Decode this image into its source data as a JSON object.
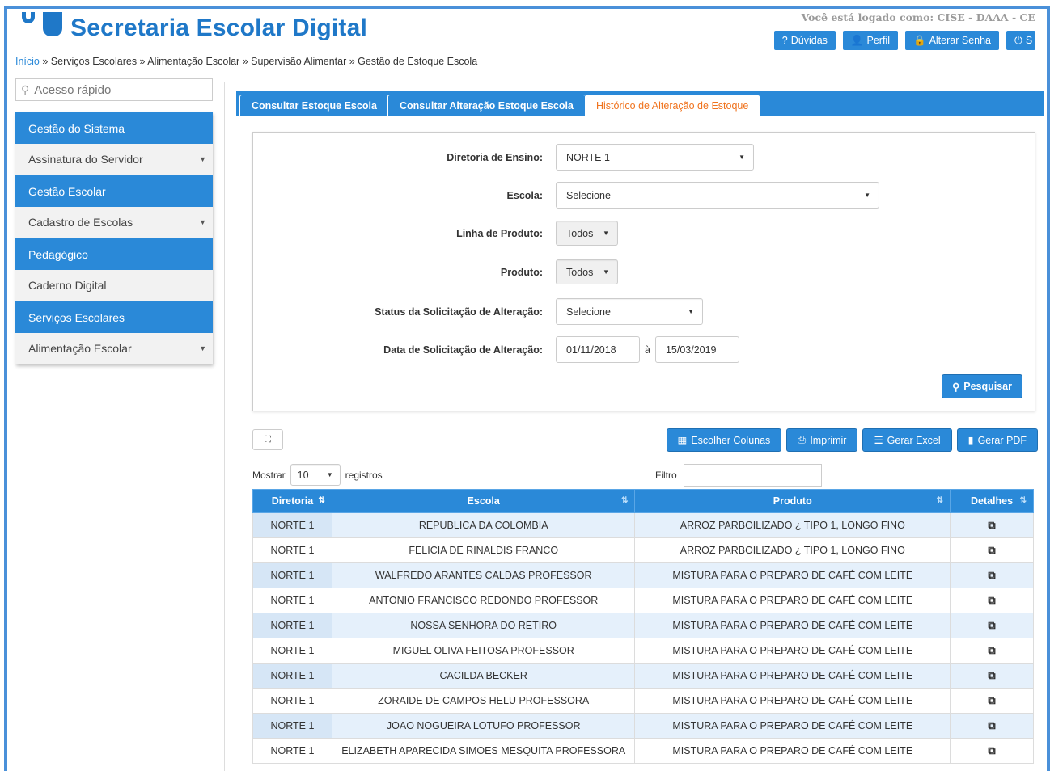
{
  "header": {
    "title": "Secretaria Escolar Digital",
    "logged_as": "Você está logado como: CISE - DAAA - CE",
    "buttons": [
      {
        "icon": "?",
        "label": "Dúvidas"
      },
      {
        "icon": "👤",
        "label": "Perfil"
      },
      {
        "icon": "🔒",
        "label": "Alterar Senha"
      },
      {
        "icon": "⏻",
        "label": "S"
      }
    ]
  },
  "breadcrumb": {
    "home": "Início",
    "rest": " » Serviços Escolares » Alimentação Escolar » Supervisão Alimentar » Gestão de Estoque Escola"
  },
  "sidebar": {
    "quick_access_placeholder": "Acesso rápido",
    "sections": [
      {
        "head": "Gestão do Sistema",
        "item": "Assinatura do Servidor",
        "caret": true
      },
      {
        "head": "Gestão Escolar",
        "item": "Cadastro de Escolas",
        "caret": true
      },
      {
        "head": "Pedagógico",
        "item": "Caderno Digital",
        "caret": false
      },
      {
        "head": "Serviços Escolares",
        "item": "Alimentação Escolar",
        "caret": true
      }
    ]
  },
  "tabs": [
    "Consultar Estoque Escola",
    "Consultar Alteração Estoque Escola",
    "Histórico de Alteração de Estoque"
  ],
  "filters": {
    "diretoria_label": "Diretoria de Ensino:",
    "diretoria_value": "NORTE 1",
    "escola_label": "Escola:",
    "escola_value": "Selecione",
    "linha_label": "Linha de Produto:",
    "linha_value": "Todos",
    "produto_label": "Produto:",
    "produto_value": "Todos",
    "status_label": "Status da Solicitação de Alteração:",
    "status_value": "Selecione",
    "data_label": "Data de Solicitação de Alteração:",
    "date_from": "01/11/2018",
    "date_sep": "à",
    "date_to": "15/03/2019",
    "search_label": "Pesquisar"
  },
  "toolbar": {
    "expand_icon": "⛶",
    "choose_columns": "Escolher Colunas",
    "print": "Imprimir",
    "excel": "Gerar Excel",
    "pdf": "Gerar PDF"
  },
  "list": {
    "show_label": "Mostrar",
    "page_size": "10",
    "records_label": "registros",
    "filter_label": "Filtro"
  },
  "table": {
    "columns": [
      "Diretoria",
      "Escola",
      "Produto",
      "Detalhes"
    ],
    "rows": [
      [
        "NORTE 1",
        "REPUBLICA DA COLOMBIA",
        "ARROZ PARBOILIZADO ¿ TIPO 1, LONGO FINO"
      ],
      [
        "NORTE 1",
        "FELICIA DE RINALDIS FRANCO",
        "ARROZ PARBOILIZADO ¿ TIPO 1, LONGO FINO"
      ],
      [
        "NORTE 1",
        "WALFREDO ARANTES CALDAS PROFESSOR",
        "MISTURA PARA O PREPARO DE CAFÉ COM LEITE"
      ],
      [
        "NORTE 1",
        "ANTONIO FRANCISCO REDONDO PROFESSOR",
        "MISTURA PARA O PREPARO DE CAFÉ COM LEITE"
      ],
      [
        "NORTE 1",
        "NOSSA SENHORA DO RETIRO",
        "MISTURA PARA O PREPARO DE CAFÉ COM LEITE"
      ],
      [
        "NORTE 1",
        "MIGUEL OLIVA FEITOSA PROFESSOR",
        "MISTURA PARA O PREPARO DE CAFÉ COM LEITE"
      ],
      [
        "NORTE 1",
        "CACILDA BECKER",
        "MISTURA PARA O PREPARO DE CAFÉ COM LEITE"
      ],
      [
        "NORTE 1",
        "ZORAIDE DE CAMPOS HELU PROFESSORA",
        "MISTURA PARA O PREPARO DE CAFÉ COM LEITE"
      ],
      [
        "NORTE 1",
        "JOAO NOGUEIRA LOTUFO PROFESSOR",
        "MISTURA PARA O PREPARO DE CAFÉ COM LEITE"
      ],
      [
        "NORTE 1",
        "ELIZABETH APARECIDA SIMOES MESQUITA PROFESSORA",
        "MISTURA PARA O PREPARO DE CAFÉ COM LEITE"
      ]
    ],
    "detail_icon": "⧉"
  }
}
